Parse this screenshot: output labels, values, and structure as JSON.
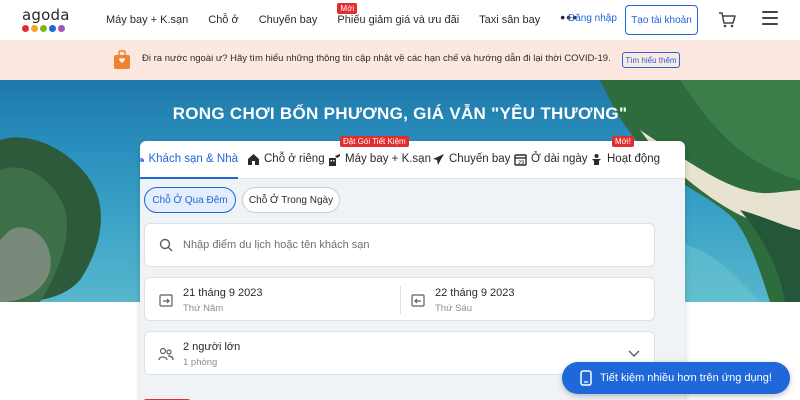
{
  "header": {
    "logo": "agoda",
    "logo_dot_colors": [
      "#e12d2d",
      "#f5a623",
      "#7ab51d",
      "#2067da",
      "#9b59b6"
    ],
    "nav": [
      {
        "label": "Máy bay + K.sạn",
        "badge": ""
      },
      {
        "label": "Chỗ ở",
        "badge": ""
      },
      {
        "label": "Chuyến bay",
        "badge": ""
      },
      {
        "label": "Phiếu giảm giá và ưu đãi",
        "badge": "Mới"
      },
      {
        "label": "Taxi sân bay",
        "badge": ""
      }
    ],
    "more": "•••",
    "login": "Đăng nhập",
    "signup": "Tạo tài khoản"
  },
  "banner": {
    "text": "Đi ra nước ngoài ư? Hãy tìm hiểu những thông tin cập nhật về các hạn chế và hướng dẫn đi lại thời COVID-19.",
    "button": "Tìm hiểu thêm"
  },
  "hero": {
    "title": "RONG CHƠI BỐN PHƯƠNG, GIÁ VẪN \"YÊU THƯƠNG\""
  },
  "tabs": [
    {
      "label": "Khách sạn & Nhà",
      "icon": "building-icon",
      "badge": "",
      "active": true
    },
    {
      "label": "Chỗ ở riêng",
      "icon": "house-icon",
      "badge": "",
      "active": false
    },
    {
      "label": "Máy bay + K.sạn",
      "icon": "flight-hotel-icon",
      "badge": "Đặt Gói Tiết Kiệm",
      "active": false
    },
    {
      "label": "Chuyến bay",
      "icon": "plane-icon",
      "badge": "",
      "active": false
    },
    {
      "label": "Ở dài ngày",
      "icon": "calendar-icon",
      "badge": "",
      "active": false
    },
    {
      "label": "Hoạt động",
      "icon": "activity-icon",
      "badge": "Mới!",
      "active": false
    }
  ],
  "stay_type": {
    "overnight": "Chỗ Ở Qua Đêm",
    "day_use": "Chỗ Ở Trong Ngày"
  },
  "search": {
    "placeholder": "Nhập điểm du lịch hoặc tên khách sạn"
  },
  "dates": {
    "checkin": {
      "date": "21 tháng 9 2023",
      "weekday": "Thứ Năm"
    },
    "checkout": {
      "date": "22 tháng 9 2023",
      "weekday": "Thứ Sáu"
    }
  },
  "guests": {
    "adults": "2 người lớn",
    "rooms": "1 phòng"
  },
  "app_promo": "Tiết kiệm nhiều hơn trên ứng dụng!",
  "colors": {
    "accent": "#2067da",
    "badge": "#e12d2d",
    "banner_bg": "#fde8e1"
  }
}
